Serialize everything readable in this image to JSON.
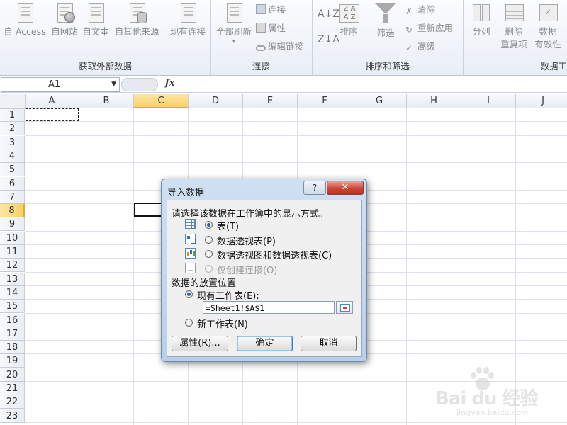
{
  "ribbon": {
    "external_group": {
      "label": "获取外部数据",
      "buttons": [
        {
          "label": "自 Access"
        },
        {
          "label": "自网站"
        },
        {
          "label": "自文本"
        },
        {
          "label": "自其他来源"
        },
        {
          "label": "现有连接"
        }
      ]
    },
    "connections_group": {
      "label": "连接",
      "refresh_all": "全部刷新",
      "connections": "连接",
      "properties": "属性",
      "edit_links": "编辑链接"
    },
    "sort_filter_group": {
      "label": "排序和筛选",
      "sort": "排序",
      "filter": "筛选",
      "clear": "清除",
      "reapply": "重新应用",
      "advanced": "高级"
    },
    "data_tools_group": {
      "label": "数据工",
      "split": "分列",
      "remove_dup_1": "删除",
      "remove_dup_2": "重复项",
      "validation_1": "数据",
      "validation_2": "有效性"
    }
  },
  "formula_bar": {
    "name_box": "A1",
    "fx": "fx",
    "formula": ""
  },
  "grid": {
    "columns": [
      "A",
      "B",
      "C",
      "D",
      "E",
      "F",
      "G",
      "H",
      "I",
      "J"
    ],
    "rows": [
      "1",
      "2",
      "3",
      "4",
      "5",
      "6",
      "7",
      "8",
      "9",
      "10",
      "11",
      "12",
      "13",
      "14",
      "15",
      "16",
      "17",
      "18",
      "19",
      "20",
      "21",
      "22",
      "23"
    ],
    "active_column": "C",
    "active_row": "8"
  },
  "dialog": {
    "title": "导入数据",
    "help": "?",
    "close": "✕",
    "prompt": "请选择该数据在工作簿中的显示方式。",
    "options": [
      {
        "label": "表(T)",
        "checked": true,
        "disabled": false,
        "icon": "table-icon"
      },
      {
        "label": "数据透视表(P)",
        "checked": false,
        "disabled": false,
        "icon": "pivot-table-icon"
      },
      {
        "label": "数据透视图和数据透视表(C)",
        "checked": false,
        "disabled": false,
        "icon": "pivot-chart-icon"
      },
      {
        "label": "仅创建连接(O)",
        "checked": false,
        "disabled": true,
        "icon": "connection-only-icon"
      }
    ],
    "placement_heading": "数据的放置位置",
    "existing_sheet": "现有工作表(E):",
    "reference": "=Sheet1!$A$1",
    "new_sheet": "新工作表(N)",
    "properties_btn": "属性(R)...",
    "ok_btn": "确定",
    "cancel_btn": "取消"
  },
  "watermark": {
    "main": "Bai du 经验",
    "sub": "jingyan.baidu.com"
  }
}
